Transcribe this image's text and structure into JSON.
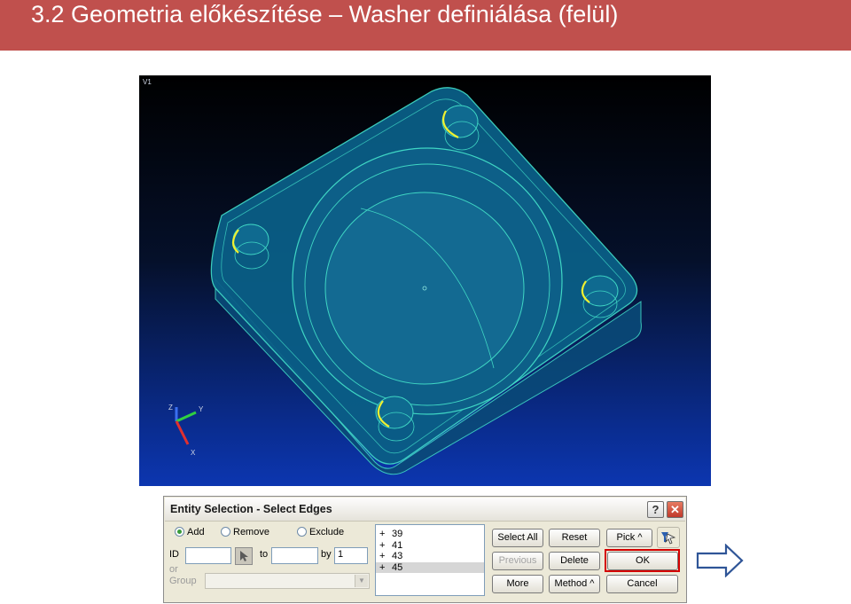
{
  "slide": {
    "title": "3.2 Geometria előkészítése – Washer definiálása (felül)"
  },
  "viewport": {
    "label": "V1",
    "axes": {
      "x": "X",
      "y": "Y",
      "z": "Z"
    }
  },
  "dialog": {
    "title": "Entity Selection - Select Edges",
    "help_label": "?",
    "close_label": "✕",
    "modes": [
      {
        "label": "Add",
        "selected": true
      },
      {
        "label": "Remove",
        "selected": false
      },
      {
        "label": "Exclude",
        "selected": false
      }
    ],
    "id_label": "ID",
    "id_value": "",
    "to_label": "to",
    "to_value": "",
    "by_label": "by",
    "by_value": "1",
    "or_label": "or",
    "group_label": "Group",
    "group_value": "",
    "list_items": [
      {
        "sign": "+",
        "value": "39"
      },
      {
        "sign": "+",
        "value": "41"
      },
      {
        "sign": "+",
        "value": "43"
      },
      {
        "sign": "+",
        "value": "45"
      }
    ],
    "buttons": {
      "select_all": "Select All",
      "reset": "Reset",
      "pick": "Pick ^",
      "previous": "Previous",
      "delete": "Delete",
      "ok": "OK",
      "more": "More",
      "method": "Method ^",
      "cancel": "Cancel"
    }
  },
  "colors": {
    "title_bar": "#c0504d",
    "geometry_edges": "#3fd6c4",
    "selected_edges": "#f0f030",
    "highlight": "#d40000"
  }
}
